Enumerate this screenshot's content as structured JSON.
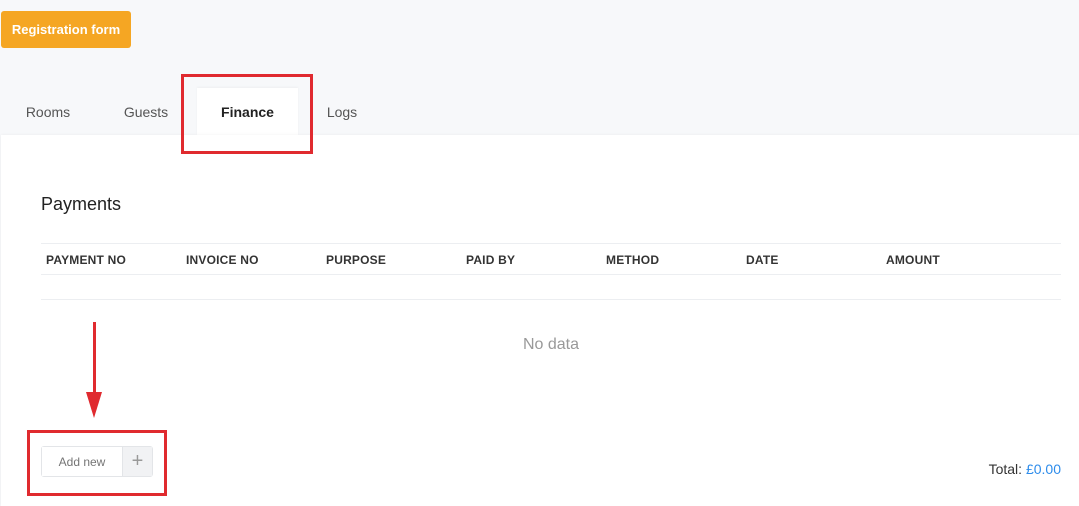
{
  "header": {
    "registration_button": "Registration form"
  },
  "tabs": [
    {
      "label": "Rooms",
      "active": false
    },
    {
      "label": "Guests",
      "active": false
    },
    {
      "label": "Finance",
      "active": true
    },
    {
      "label": "Logs",
      "active": false
    }
  ],
  "payments": {
    "title": "Payments",
    "columns": [
      "PAYMENT NO",
      "INVOICE NO",
      "PURPOSE",
      "PAID BY",
      "METHOD",
      "DATE",
      "AMOUNT"
    ],
    "rows": [],
    "empty_text": "No data",
    "add_new_placeholder": "Add new",
    "add_icon": "plus-icon",
    "total_label": "Total:",
    "total_value": "£0.00"
  },
  "colors": {
    "accent": "#f5a623",
    "annotation": "#e02a2f",
    "link": "#2d8ceb"
  }
}
